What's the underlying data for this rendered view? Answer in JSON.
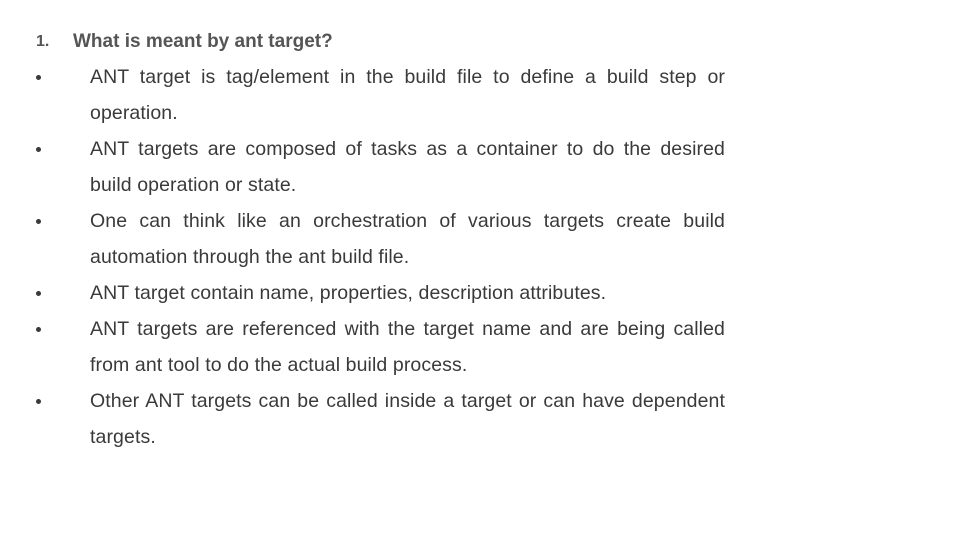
{
  "question": {
    "number": "1.",
    "title": "What is meant by ant target?"
  },
  "bullets": [
    "ANT target is tag/element in the build file to define a build step or operation.",
    "ANT targets are composed of tasks as a container to do the desired build operation or state.",
    "One can think like an orchestration of various targets create build automation through the ant build file.",
    "ANT target contain name, properties, description attributes.",
    "ANT targets are referenced with the target name and are being called from ant tool to do the actual build process.",
    "Other ANT targets can be called inside a target or can have dependent targets."
  ]
}
